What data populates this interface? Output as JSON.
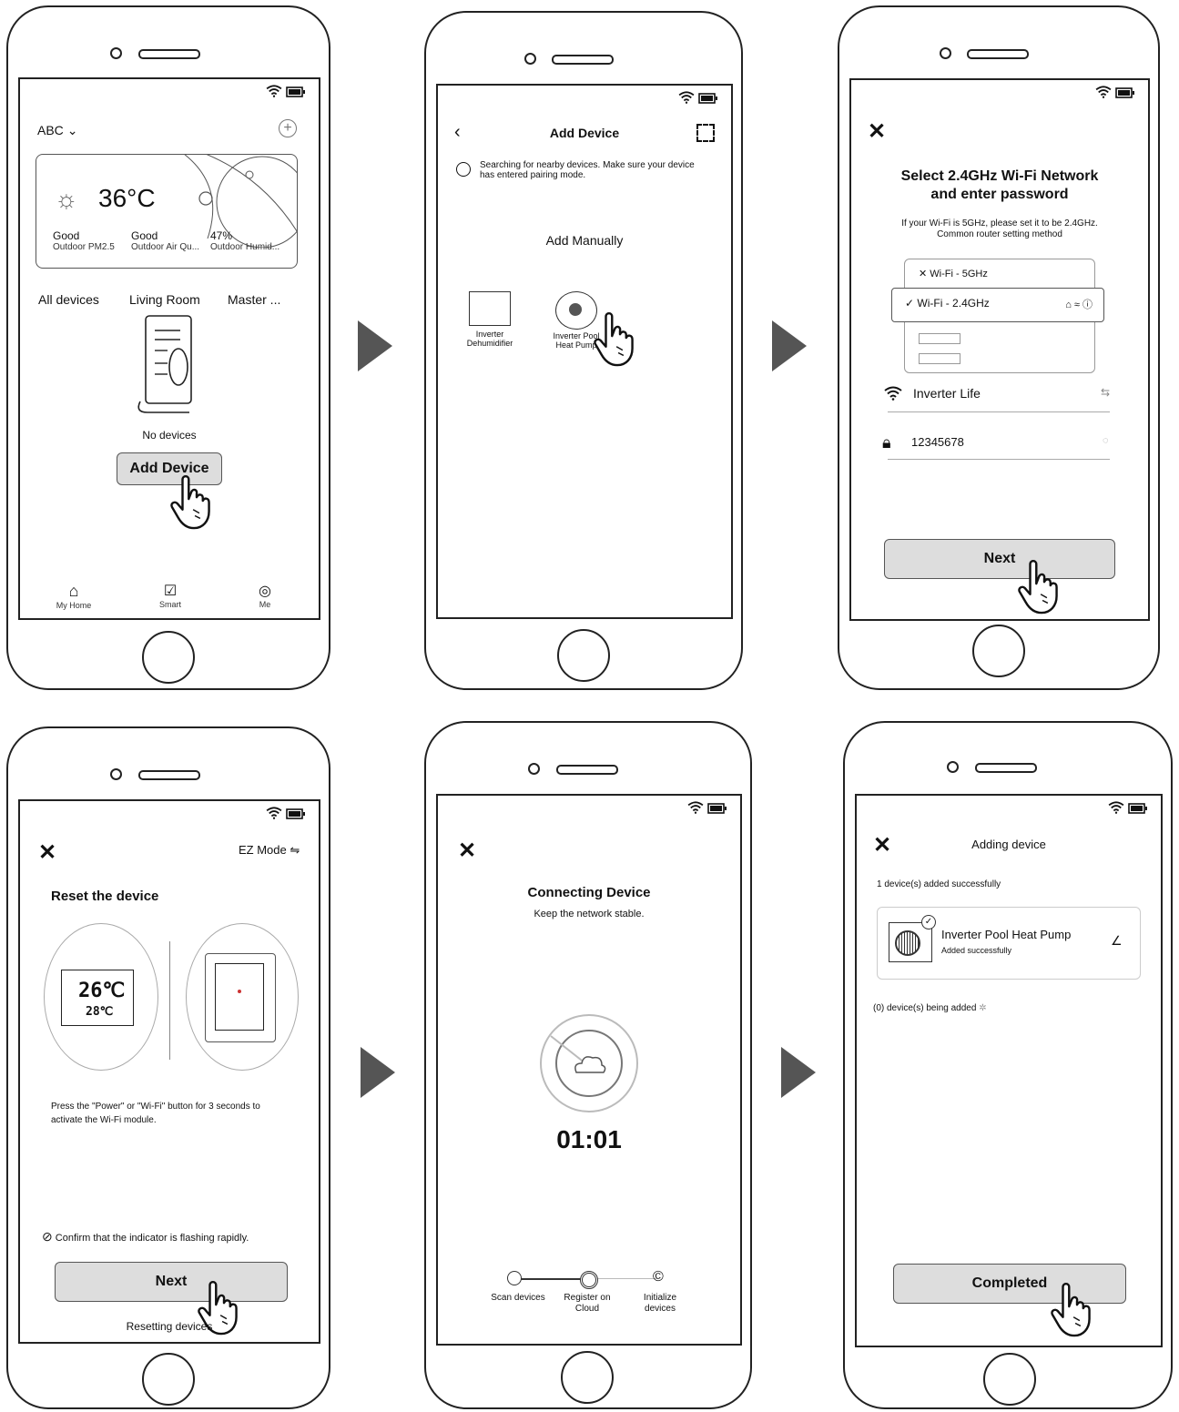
{
  "s1": {
    "location": "ABC",
    "temp": "36°C",
    "w1v": "Good",
    "w1l": "Outdoor PM2.5",
    "w2v": "Good",
    "w2l": "Outdoor Air Qu...",
    "w3v": "47%",
    "w3l": "Outdoor Humid...",
    "tab1": "All devices",
    "tab2": "Living Room",
    "tab3": "Master ...",
    "empty": "No devices",
    "add": "Add  Device",
    "nav1": "My Home",
    "nav2": "Smart",
    "nav3": "Me"
  },
  "s2": {
    "title": "Add  Device",
    "hint": "Searching for nearby devices. Make sure your device has entered pairing mode.",
    "manual": "Add Manually",
    "dev1": "Inverter Dehumidifier",
    "dev2": "Inverter Pool Heat Pump"
  },
  "s3": {
    "title": "Select 2.4GHz Wi-Fi Network and enter password",
    "sub": "If your Wi-Fi is 5GHz, please set it to be 2.4GHz. Common router setting method",
    "net1": "Wi-Fi - 5GHz",
    "net2": "Wi-Fi - 2.4GHz",
    "ssid": "Inverter Life",
    "pwd": "12345678",
    "next": "Next"
  },
  "s4": {
    "mode": "EZ Mode",
    "title": "Reset the device",
    "lcd1": "26℃",
    "lcd2": "28℃",
    "desc": "Press the \"Power\" or \"Wi-Fi\" button for 3 seconds to activate the Wi-Fi module.",
    "confirm": "Confirm that the indicator is flashing rapidly.",
    "next": "Next",
    "foot": "Resetting devices"
  },
  "s5": {
    "title": "Connecting Device",
    "sub": "Keep the network stable.",
    "timer": "01:01",
    "step1": "Scan devices",
    "step2": "Register on Cloud",
    "step3": "Initialize devices"
  },
  "s6": {
    "title": "Adding device",
    "ok": "1 device(s) added successfully",
    "dev": "Inverter Pool Heat Pump",
    "devsub": "Added successfully",
    "pending": "(0) device(s) being added",
    "done": "Completed"
  }
}
